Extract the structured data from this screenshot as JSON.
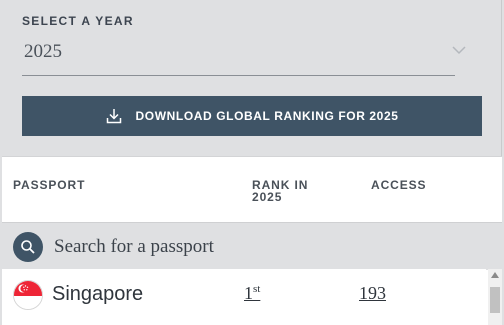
{
  "year_selector": {
    "label": "SELECT A YEAR",
    "value": "2025",
    "icon": "chevron-down-icon"
  },
  "download_button": {
    "label": "DOWNLOAD GLOBAL RANKING FOR 2025",
    "icon": "download-icon"
  },
  "table": {
    "headers": {
      "passport": "PASSPORT",
      "rank": "RANK IN 2025",
      "access": "ACCESS"
    },
    "search": {
      "placeholder": "Search for a passport",
      "icon": "search-icon"
    },
    "rows": [
      {
        "country": "Singapore",
        "rank": "1",
        "rank_suffix": "st",
        "access": "193",
        "flag": "singapore-flag-icon"
      }
    ]
  },
  "colors": {
    "page_bg": "#dfe0e2",
    "button_bg": "#3f5466",
    "text_dark": "#2f353c"
  }
}
